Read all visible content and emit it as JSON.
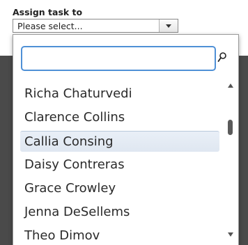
{
  "form": {
    "label": "Assign task to",
    "select_value": "Please select..."
  },
  "dropdown": {
    "search_value": "",
    "search_placeholder": "",
    "items": [
      {
        "label": "Richa Chaturvedi",
        "selected": false
      },
      {
        "label": "Clarence Collins",
        "selected": false
      },
      {
        "label": "Callia Consing",
        "selected": true
      },
      {
        "label": "Daisy Contreras",
        "selected": false
      },
      {
        "label": "Grace Crowley",
        "selected": false
      },
      {
        "label": "Jenna DeSellems",
        "selected": false
      },
      {
        "label": "Theo Dimov",
        "selected": false
      }
    ]
  },
  "icons": {
    "search": "search-icon",
    "select_arrow": "chevron-down-icon",
    "scroll_up": "scroll-up-arrow-icon",
    "scroll_down": "scroll-down-arrow-icon"
  },
  "colors": {
    "focus_border": "#4f90d6",
    "selected_row": "#e3eaf3"
  }
}
